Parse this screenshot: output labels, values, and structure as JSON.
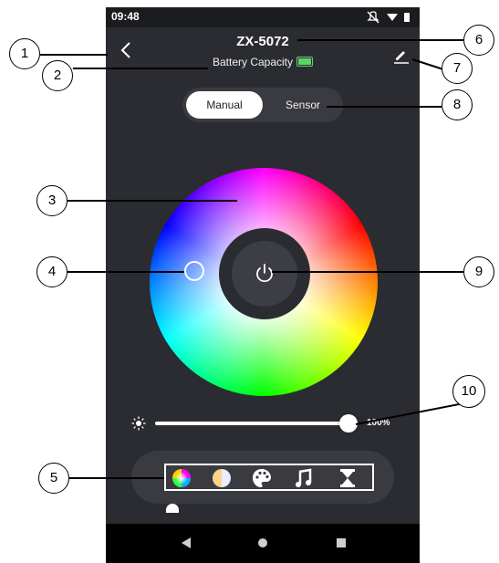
{
  "status_bar": {
    "time": "09:48",
    "icons": [
      "mute-icon",
      "wifi-icon",
      "battery-icon"
    ]
  },
  "header": {
    "title": "ZX-5072",
    "battery_label": "Battery Capacity"
  },
  "tabs": [
    {
      "label": "Manual",
      "active": true
    },
    {
      "label": "Sensor",
      "active": false
    }
  ],
  "brightness": {
    "percent_label": "100%",
    "level": 1.0
  },
  "modes": [
    "color-wheel-icon",
    "white-balance-icon",
    "palette-icon",
    "music-icon",
    "timer-icon"
  ],
  "nav": [
    "back-triangle-icon",
    "home-circle-icon",
    "recents-square-icon"
  ],
  "callouts": [
    "1",
    "2",
    "3",
    "4",
    "5",
    "6",
    "7",
    "8",
    "9",
    "10"
  ],
  "colors": {
    "screen_bg": "#2b2c31",
    "battery": "#5fd36b",
    "control_bg": "#3a3b41"
  }
}
